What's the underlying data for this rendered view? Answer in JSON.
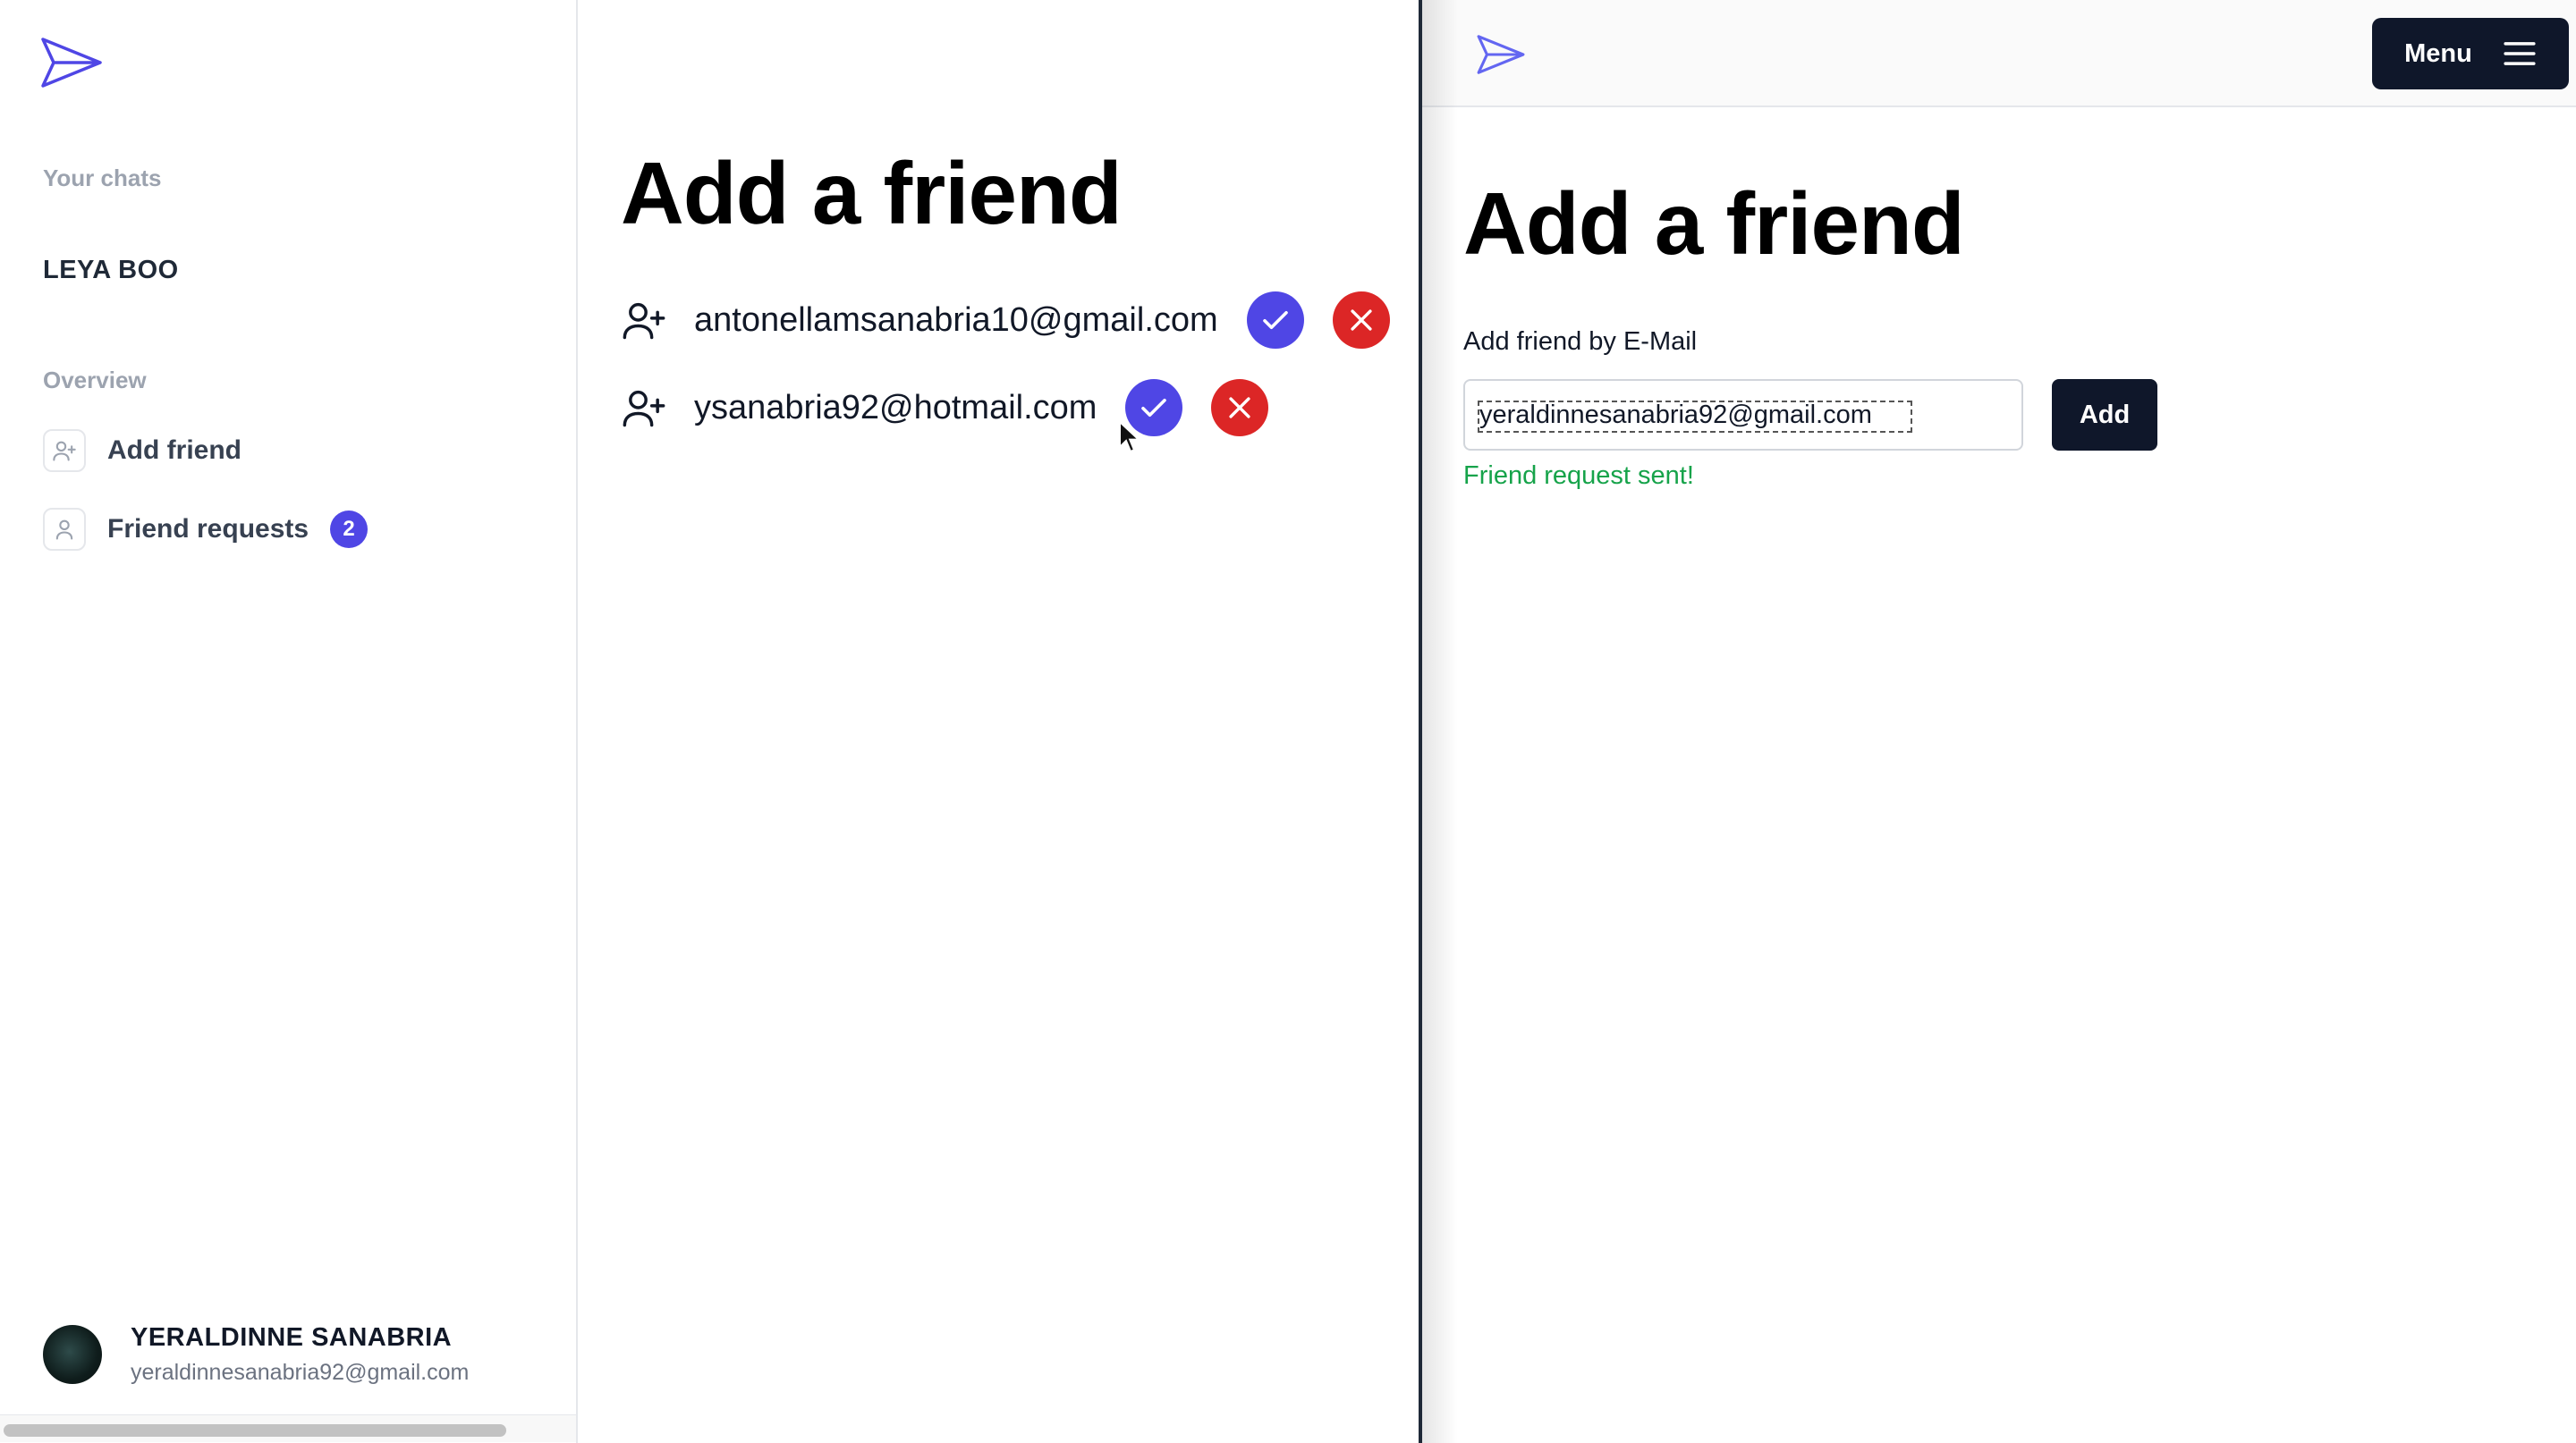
{
  "left_window": {
    "sidebar": {
      "chats_heading": "Your chats",
      "chats": [
        "LEYA BOO"
      ],
      "overview_heading": "Overview",
      "nav": [
        {
          "label": "Add friend",
          "icon": "user-plus-icon"
        },
        {
          "label": "Friend requests",
          "icon": "user-icon",
          "badge": "2"
        }
      ],
      "user": {
        "name": "YERALDINNE SANABRIA",
        "email": "yeraldinnesanabria92@gmail.com"
      }
    },
    "main": {
      "title": "Add a friend",
      "requests": [
        {
          "email": "antonellamsanabria10@gmail.com"
        },
        {
          "email": "ysanabria92@hotmail.com"
        }
      ]
    }
  },
  "right_window": {
    "header": {
      "menu_label": "Menu"
    },
    "title": "Add a friend",
    "field_label": "Add friend by E-Mail",
    "email_value": "yeraldinnesanabria92@gmail.com",
    "add_label": "Add",
    "status_message": "Friend request sent!"
  },
  "colors": {
    "accent": "#4f46e5",
    "deny": "#dc2626",
    "dark_button": "#0f172a",
    "success": "#16a34a"
  }
}
